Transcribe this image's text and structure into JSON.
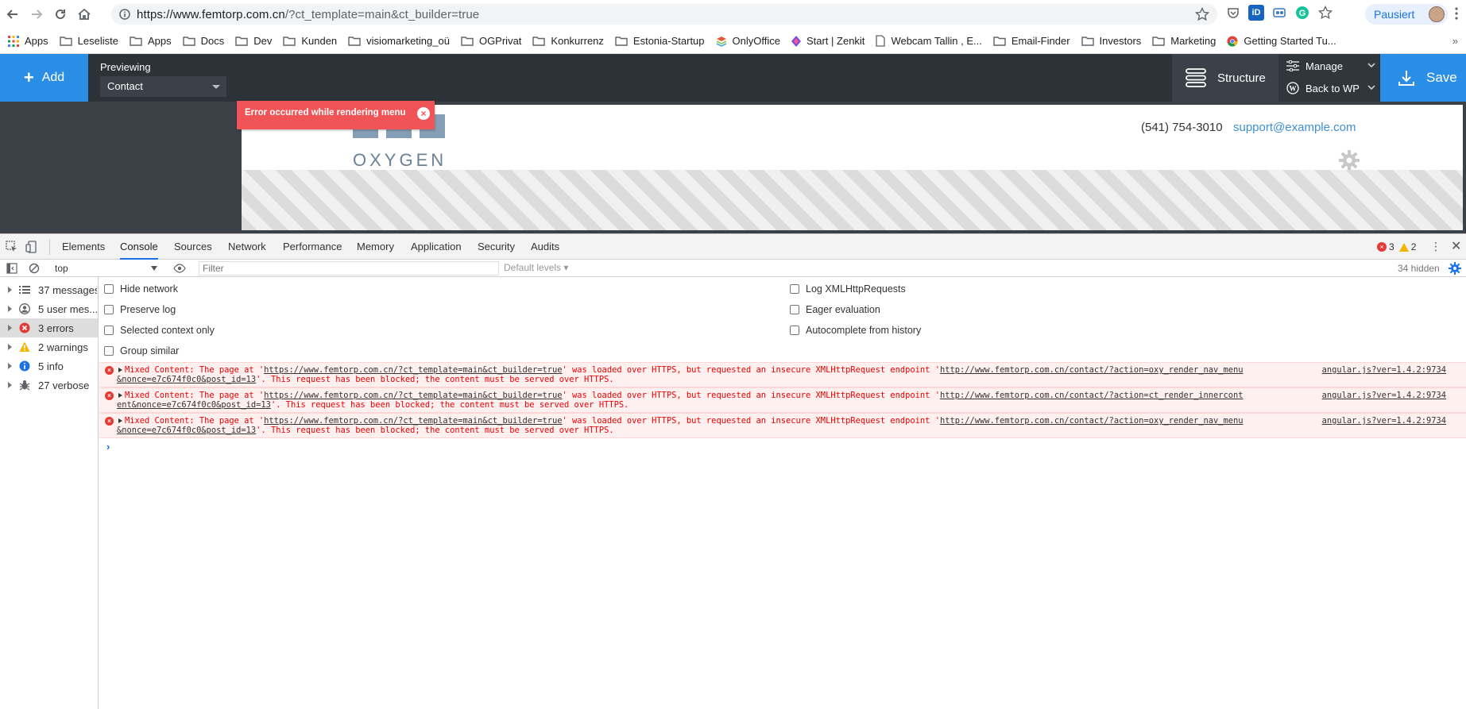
{
  "browser": {
    "url_host": "https://www.femtorp.com.cn",
    "url_rest": "/?ct_template=main&ct_builder=true",
    "profile_label": "Pausiert"
  },
  "bookmarks": [
    {
      "label": "Apps",
      "icon": "apps-grid-icon"
    },
    {
      "label": "Leseliste",
      "icon": "folder-icon"
    },
    {
      "label": "Apps",
      "icon": "folder-icon"
    },
    {
      "label": "Docs",
      "icon": "folder-icon"
    },
    {
      "label": "Dev",
      "icon": "folder-icon"
    },
    {
      "label": "Kunden",
      "icon": "folder-icon"
    },
    {
      "label": "visiomarketing_oü",
      "icon": "folder-icon"
    },
    {
      "label": "OGPrivat",
      "icon": "folder-icon"
    },
    {
      "label": "Konkurrenz",
      "icon": "folder-icon"
    },
    {
      "label": "Estonia-Startup",
      "icon": "folder-icon"
    },
    {
      "label": "OnlyOffice",
      "icon": "onlyoffice-icon"
    },
    {
      "label": "Start | Zenkit",
      "icon": "zenkit-icon"
    },
    {
      "label": "Webcam Tallin , E...",
      "icon": "page-icon"
    },
    {
      "label": "Email-Finder",
      "icon": "folder-icon"
    },
    {
      "label": "Investors",
      "icon": "folder-icon"
    },
    {
      "label": "Marketing",
      "icon": "folder-icon"
    },
    {
      "label": "Getting Started Tu...",
      "icon": "chrome-icon"
    }
  ],
  "bookmarks_more": "»",
  "oxygen": {
    "add_label": "Add",
    "previewing_label": "Previewing",
    "preview_value": "Contact",
    "structure_label": "Structure",
    "manage_label": "Manage",
    "back_to_wp_label": "Back to WP",
    "save_label": "Save",
    "error_toast": "Error occurred while rendering menu",
    "error_close": "×",
    "site": {
      "logo": "OXYGEN",
      "phone": "(541) 754-3010",
      "email": "support@example.com"
    }
  },
  "devtools": {
    "tabs": [
      "Elements",
      "Console",
      "Sources",
      "Network",
      "Performance",
      "Memory",
      "Application",
      "Security",
      "Audits"
    ],
    "active_tab": "Console",
    "error_count": "3",
    "warning_count": "2",
    "context": "top",
    "filter_placeholder": "Filter",
    "levels_label": "Default levels ▾",
    "hidden_count": "34 hidden",
    "sidebar": [
      {
        "label": "37 messages",
        "icon": "list-icon"
      },
      {
        "label": "5 user mes...",
        "icon": "user-icon"
      },
      {
        "label": "3 errors",
        "icon": "error-icon"
      },
      {
        "label": "2 warnings",
        "icon": "warning-icon"
      },
      {
        "label": "5 info",
        "icon": "info-icon"
      },
      {
        "label": "27 verbose",
        "icon": "bug-icon"
      }
    ],
    "settings_left": [
      "Hide network",
      "Preserve log",
      "Selected context only",
      "Group similar"
    ],
    "settings_right": [
      "Log XMLHttpRequests",
      "Eager evaluation",
      "Autocomplete from history"
    ],
    "messages": [
      {
        "prefix": "Mixed Content: The page at '",
        "page_url": "https://www.femtorp.com.cn/?ct_template=main&ct_builder=true",
        "mid": "' was loaded over HTTPS, but requested an insecure XMLHttpRequest endpoint '",
        "endpoint_a": "http://www.femtorp.com.cn/contact/?action=oxy_render_nav_menu",
        "endpoint_b": "&nonce=e7c674f0c0&post_id=13",
        "suffix": "'. This request has been blocked; the content must be served over HTTPS.",
        "source": "angular.js?ver=1.4.2:9734"
      },
      {
        "prefix": "Mixed Content: The page at '",
        "page_url": "https://www.femtorp.com.cn/?ct_template=main&ct_builder=true",
        "mid": "' was loaded over HTTPS, but requested an insecure XMLHttpRequest endpoint '",
        "endpoint_a": "http://www.femtorp.com.cn/contact/?action=ct_render_innercont",
        "endpoint_b": "ent&nonce=e7c674f0c0&post_id=13",
        "suffix": "'. This request has been blocked; the content must be served over HTTPS.",
        "source": "angular.js?ver=1.4.2:9734"
      },
      {
        "prefix": "Mixed Content: The page at '",
        "page_url": "https://www.femtorp.com.cn/?ct_template=main&ct_builder=true",
        "mid": "' was loaded over HTTPS, but requested an insecure XMLHttpRequest endpoint '",
        "endpoint_a": "http://www.femtorp.com.cn/contact/?action=oxy_render_nav_menu",
        "endpoint_b": "&nonce=e7c674f0c0&post_id=13",
        "suffix": "'. This request has been blocked; the content must be served over HTTPS.",
        "source": "angular.js?ver=1.4.2:9734"
      }
    ],
    "prompt": "›"
  },
  "colors": {
    "oxygen_blue": "#2b8ee6",
    "oxygen_dark": "#2c3238",
    "error_red": "#f05456",
    "console_error": "#e00000"
  }
}
